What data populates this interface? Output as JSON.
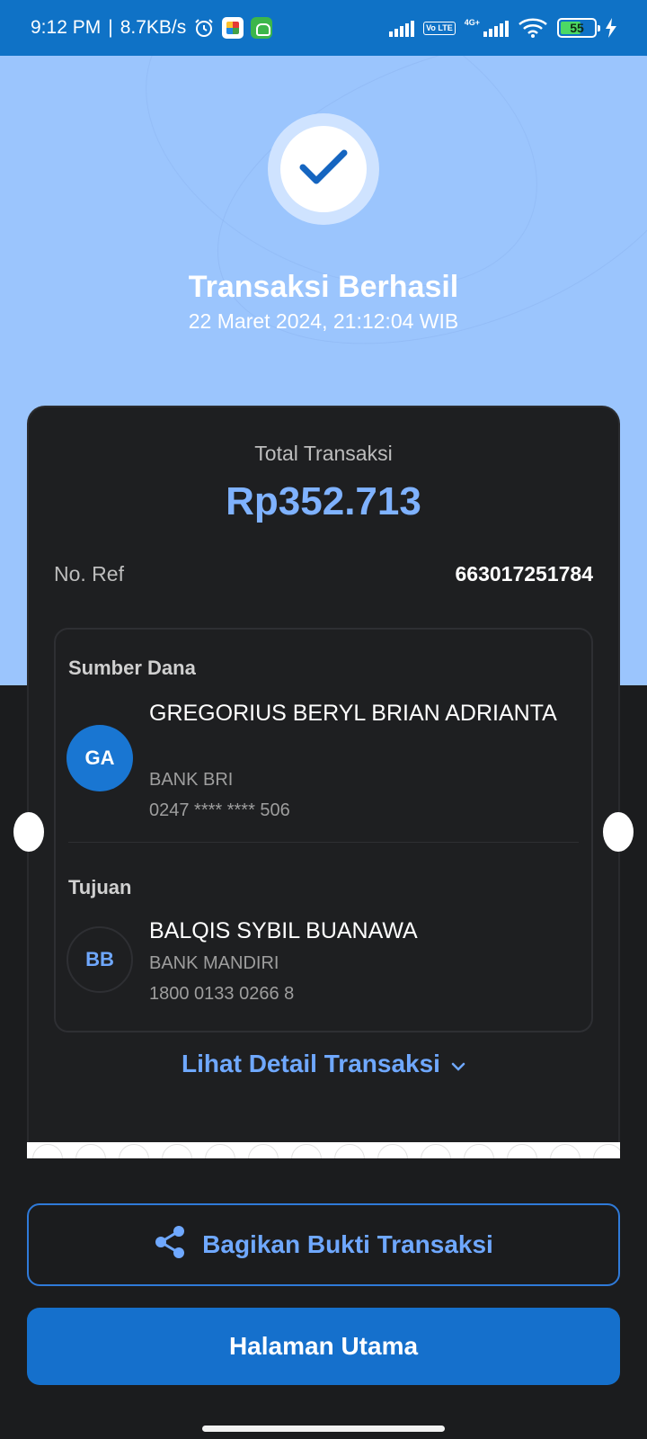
{
  "status_bar": {
    "time": "9:12 PM",
    "net_speed": "8.7KB/s",
    "volte": "Vo LTE",
    "network": "4G+",
    "battery": "55",
    "icons": [
      "alarm-icon",
      "app-icon",
      "app-icon",
      "signal-icon",
      "signal-icon",
      "wifi-icon",
      "battery-icon",
      "charging-icon"
    ]
  },
  "hero": {
    "title": "Transaksi Berhasil",
    "datetime": "22 Maret 2024, 21:12:04 WIB"
  },
  "summary": {
    "total_label": "Total Transaksi",
    "total_amount": "Rp352.713",
    "ref_label": "No. Ref",
    "ref_value": "663017251784"
  },
  "source": {
    "section_title": "Sumber Dana",
    "initials": "GA",
    "name": "GREGORIUS BERYL BRIAN ADRIANTA",
    "bank": "BANK BRI",
    "account": "0247 **** **** 506"
  },
  "destination": {
    "section_title": "Tujuan",
    "initials": "BB",
    "name": "BALQIS SYBIL BUANAWA",
    "bank": "BANK MANDIRI",
    "account": "1800 0133 0266 8"
  },
  "actions": {
    "detail_link": "Lihat Detail Transaksi",
    "share_button": "Bagikan Bukti Transaksi",
    "home_button": "Halaman Utama"
  },
  "colors": {
    "status_bar": "#0f72c6",
    "hero_bg": "#9bc5fd",
    "card_bg": "#1e1f21",
    "accent": "#6fa8ff",
    "primary_button": "#1570cc"
  }
}
